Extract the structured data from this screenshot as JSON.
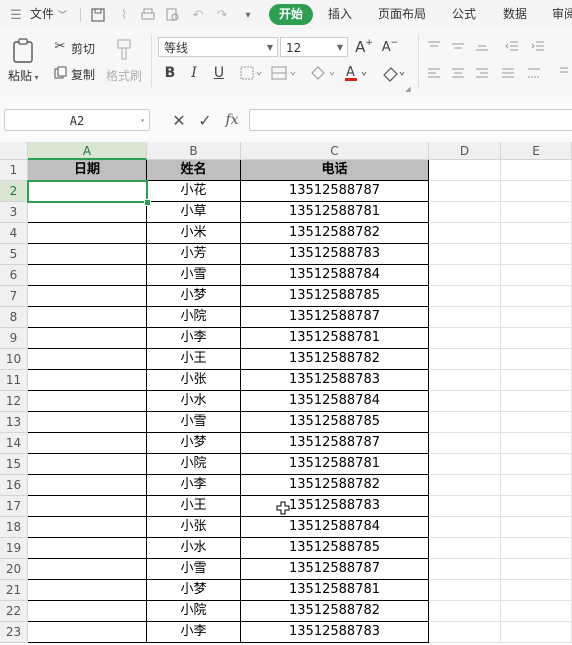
{
  "menubar": {
    "file_label": "文件",
    "tabs": [
      {
        "label": "开始"
      },
      {
        "label": "插入"
      },
      {
        "label": "页面布局"
      },
      {
        "label": "公式"
      },
      {
        "label": "数据"
      },
      {
        "label": "审阅"
      }
    ],
    "icons": [
      "hamburger-icon",
      "chevron-down-icon",
      "save-icon",
      "format-painter-icon",
      "print-icon",
      "print-preview-icon",
      "undo-icon",
      "redo-icon",
      "more-icon"
    ]
  },
  "ribbon": {
    "paste_label": "粘贴",
    "cut_label": "剪切",
    "copy_label": "复制",
    "format_painter_label": "格式刷",
    "font_name": "等线",
    "font_size": "12",
    "bold": "B",
    "italic": "I",
    "underline": "U"
  },
  "formula_bar": {
    "cell_ref": "A2",
    "fx_label": "fx",
    "value": ""
  },
  "sheet": {
    "columns": [
      "A",
      "B",
      "C",
      "D",
      "E"
    ],
    "selected_column": "A",
    "selected_row": "2",
    "header_row": {
      "a": "日期",
      "b": "姓名",
      "c": "电话"
    },
    "rows": [
      {
        "num": "1"
      },
      {
        "num": "2",
        "name": "小花",
        "phone": "13512588787"
      },
      {
        "num": "3",
        "name": "小草",
        "phone": "13512588781"
      },
      {
        "num": "4",
        "name": "小米",
        "phone": "13512588782"
      },
      {
        "num": "5",
        "name": "小芳",
        "phone": "13512588783"
      },
      {
        "num": "6",
        "name": "小雪",
        "phone": "13512588784"
      },
      {
        "num": "7",
        "name": "小梦",
        "phone": "13512588785"
      },
      {
        "num": "8",
        "name": "小院",
        "phone": "13512588787"
      },
      {
        "num": "9",
        "name": "小李",
        "phone": "13512588781"
      },
      {
        "num": "10",
        "name": "小王",
        "phone": "13512588782"
      },
      {
        "num": "11",
        "name": "小张",
        "phone": "13512588783"
      },
      {
        "num": "12",
        "name": "小水",
        "phone": "13512588784"
      },
      {
        "num": "13",
        "name": "小雪",
        "phone": "13512588785"
      },
      {
        "num": "14",
        "name": "小梦",
        "phone": "13512588787"
      },
      {
        "num": "15",
        "name": "小院",
        "phone": "13512588781"
      },
      {
        "num": "16",
        "name": "小李",
        "phone": "13512588782"
      },
      {
        "num": "17",
        "name": "小王",
        "phone": "13512588783"
      },
      {
        "num": "18",
        "name": "小张",
        "phone": "13512588784"
      },
      {
        "num": "19",
        "name": "小水",
        "phone": "13512588785"
      },
      {
        "num": "20",
        "name": "小雪",
        "phone": "13512588787"
      },
      {
        "num": "21",
        "name": "小梦",
        "phone": "13512588781"
      },
      {
        "num": "22",
        "name": "小院",
        "phone": "13512588782"
      },
      {
        "num": "23",
        "name": "小李",
        "phone": "13512588783"
      }
    ]
  },
  "colors": {
    "accent": "#2d9e52",
    "header_fill": "#bfbfbf"
  }
}
